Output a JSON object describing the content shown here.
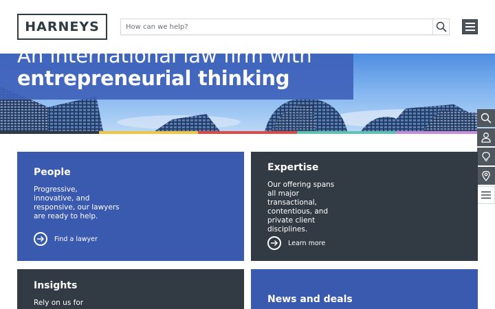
{
  "header": {
    "logo_text": "HARNEYS",
    "search_placeholder": "How can we help?",
    "search_icon": "search-icon",
    "menu_icon": "hamburger-menu-icon"
  },
  "hero": {
    "line1": "An international law firm with",
    "line2": "entrepreneurial thinking"
  },
  "stripe_colors": [
    "#2f3942",
    "#f2c53a",
    "#e04646",
    "#5cc3b1",
    "#c98ad6"
  ],
  "side_toolbar": {
    "items": [
      {
        "icon": "search-icon"
      },
      {
        "icon": "person-icon"
      },
      {
        "icon": "lightbulb-icon"
      },
      {
        "icon": "location-pin-icon"
      },
      {
        "icon": "menu-icon"
      }
    ]
  },
  "cards": {
    "people": {
      "title": "People",
      "text": "Progressive, innovative, and responsive, our lawyers are ready to help.",
      "link": "Find a lawyer"
    },
    "expertise": {
      "title": "Expertise",
      "text": "Our offering spans all major transactional, contentious, and private client disciplines.",
      "link": "Learn more"
    },
    "insights": {
      "title": "Insights",
      "text": "Rely on us for"
    },
    "news": {
      "title": "News and deals"
    }
  },
  "colors": {
    "card_blue": "#3a5aaf",
    "card_dark": "#323b43",
    "hero_overlay": "#3f62ba"
  }
}
